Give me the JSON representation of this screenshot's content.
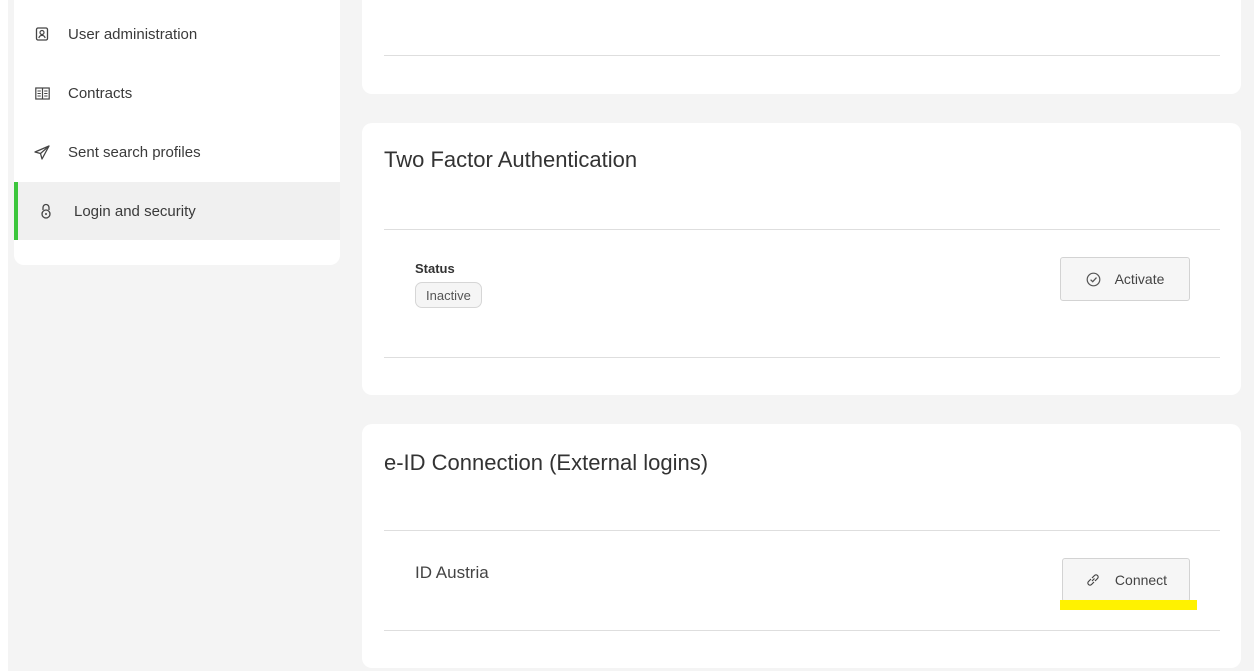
{
  "sidebar": {
    "items": [
      {
        "label": "User administration",
        "icon": "user-badge-icon",
        "active": false
      },
      {
        "label": "Contracts",
        "icon": "contracts-icon",
        "active": false
      },
      {
        "label": "Sent search profiles",
        "icon": "paper-plane-icon",
        "active": false
      },
      {
        "label": "Login and security",
        "icon": "lock-icon",
        "active": true
      }
    ]
  },
  "two_factor": {
    "title": "Two Factor Authentication",
    "status_label": "Status",
    "status_value": "Inactive",
    "activate_label": "Activate"
  },
  "eid": {
    "title": "e-ID Connection (External logins)",
    "provider": "ID Austria",
    "connect_label": "Connect"
  },
  "colors": {
    "accent": "#3cc63c",
    "highlight": "#fff200",
    "background": "#f4f4f4"
  }
}
